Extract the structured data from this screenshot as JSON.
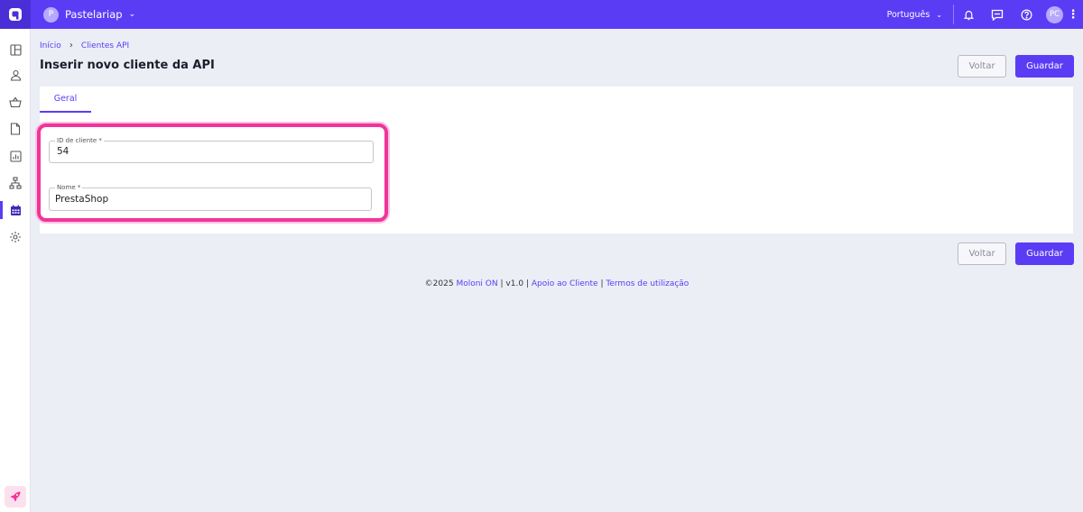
{
  "topbar": {
    "company_initial": "P",
    "company_name": "Pastelariap",
    "language": "Português",
    "user_initials": "PC"
  },
  "breadcrumb": {
    "home": "Início",
    "current": "Clientes API"
  },
  "page": {
    "title": "Inserir novo cliente da API"
  },
  "actions": {
    "back_label": "Voltar",
    "save_label": "Guardar"
  },
  "tabs": [
    {
      "label": "Geral"
    }
  ],
  "form": {
    "client_id": {
      "label": "ID de cliente *",
      "value": "54"
    },
    "name": {
      "label": "Nome *",
      "value": "PrestaShop"
    }
  },
  "footer": {
    "copyright": "©2025",
    "product": "Moloni ON",
    "version": "v1.0",
    "support": "Apoio ao Cliente",
    "terms": "Termos de utilização",
    "divider": "|"
  },
  "colors": {
    "accent": "#5b3cf5",
    "highlight": "#f0359a"
  }
}
